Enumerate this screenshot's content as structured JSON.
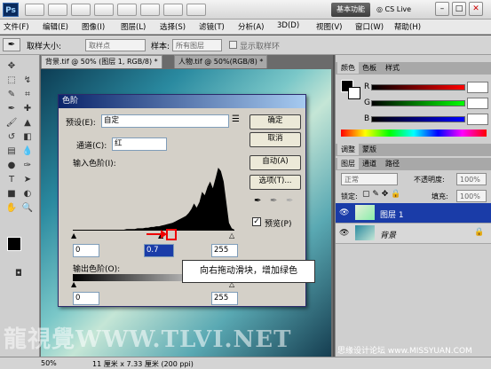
{
  "app": {
    "logo": "Ps",
    "workspace_button": "基本功能",
    "cslive": "CS Live",
    "menus": [
      "文件(F)",
      "编辑(E)",
      "图像(I)",
      "图层(L)",
      "选择(S)",
      "滤镜(T)",
      "分析(A)",
      "3D(D)",
      "视图(V)",
      "窗口(W)",
      "帮助(H)"
    ]
  },
  "options": {
    "sample_size_label": "取样大小:",
    "sample_size_value": "取样点",
    "sample_label": "样本:",
    "sample_value": "所有图层",
    "show_ring_label": "显示取样环"
  },
  "tabs": {
    "doc1": "背景.tif @ 50% (图层 1, RGB/8) *",
    "doc2": "人物.tif @ 50%(RGB/8) *"
  },
  "dialog": {
    "title": "色阶",
    "preset_label": "预设(E):",
    "preset_value": "自定",
    "channel_label": "通道(C):",
    "channel_value": "红",
    "input_levels_label": "输入色阶(I):",
    "input_black": "0",
    "input_mid": "0.7",
    "input_white": "255",
    "output_levels_label": "输出色阶(O):",
    "output_black": "0",
    "output_white": "255",
    "btn_ok": "确定",
    "btn_cancel": "取消",
    "btn_auto": "自动(A)",
    "btn_options": "选项(T)...",
    "preview_label": "预览(P)",
    "preview_checked": true,
    "histogram": [
      0,
      0,
      0,
      0,
      0,
      0,
      0,
      0,
      0,
      0,
      0,
      0,
      0,
      0,
      0,
      0,
      0,
      0,
      0,
      0,
      1,
      1,
      1,
      1,
      2,
      2,
      2,
      3,
      3,
      4,
      4,
      5,
      5,
      6,
      7,
      8,
      9,
      10,
      12,
      14,
      16,
      18,
      20,
      24,
      30,
      38,
      32,
      40,
      55,
      50,
      62,
      70,
      60,
      75,
      90,
      85,
      70,
      40,
      10,
      2
    ]
  },
  "callout": "向右拖动滑块，增加绿色",
  "panels": {
    "color_tabs": [
      "颜色",
      "色板",
      "样式"
    ],
    "channels": [
      {
        "name": "R",
        "value": "",
        "color": "#ff0000"
      },
      {
        "name": "G",
        "value": "",
        "color": "#00ff00"
      },
      {
        "name": "B",
        "value": "",
        "color": "#0000ff"
      }
    ],
    "adjust_tabs": [
      "调整",
      "蒙版"
    ],
    "layers_tabs": [
      "图层",
      "通道",
      "路径"
    ],
    "blend_mode": "正常",
    "opacity_label": "不透明度:",
    "opacity_value": "100%",
    "lock_label": "锁定:",
    "fill_label": "填充:",
    "fill_value": "100%",
    "layers": [
      {
        "name": "图层 1",
        "selected": true
      },
      {
        "name": "背景",
        "selected": false
      }
    ]
  },
  "status": {
    "zoom": "50%",
    "doc_info": "11 厘米 x 7.33 厘米 (200 ppi)"
  },
  "watermark": "龍視覺WWW.TLVI.NET",
  "watermark2": "思缘设计论坛 www.MISSYUAN.COM"
}
